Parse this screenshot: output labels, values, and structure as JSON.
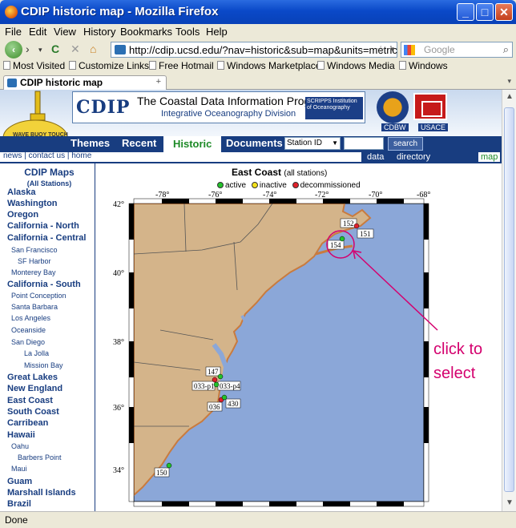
{
  "window": {
    "title": "CDIP historic map - Mozilla Firefox"
  },
  "menu": [
    "File",
    "Edit",
    "View",
    "History",
    "Bookmarks",
    "Tools",
    "Help"
  ],
  "toolbar": {
    "url": "http://cdip.ucsd.edu/?nav=historic&sub=map&units=metric",
    "search_placeholder": "Google"
  },
  "bookmarks": [
    "Most Visited",
    "Customize Links",
    "Free Hotmail",
    "Windows Marketplace",
    "Windows Media",
    "Windows"
  ],
  "tab": {
    "label": "CDIP historic map"
  },
  "site": {
    "logo": "CDIP",
    "title": "The Coastal Data Information Program",
    "subtitle": "Integrative Oceanography Division",
    "scripps": "SCRIPPS Institution of Oceanography",
    "cdbw": "CDBW",
    "usace": "USACE",
    "buoy_text": "WAVE BUOY TOUCH",
    "nav_tabs": [
      "Themes",
      "Recent",
      "Historic",
      "Documents"
    ],
    "active_tab": "Historic",
    "station_select": "Station ID",
    "search_button": "search",
    "sub_links": "news | contact us | home",
    "right_links": [
      "data",
      "directory",
      "map"
    ]
  },
  "sidebar": {
    "title": "CDIP Maps",
    "subtitle": "(All Stations)",
    "items": [
      {
        "label": "Alaska",
        "level": 0
      },
      {
        "label": "Washington",
        "level": 0
      },
      {
        "label": "Oregon",
        "level": 0
      },
      {
        "label": "California - North",
        "level": 0
      },
      {
        "label": "California - Central",
        "level": 0
      },
      {
        "label": "San Francisco",
        "level": 1
      },
      {
        "label": "SF Harbor",
        "level": 2
      },
      {
        "label": "Monterey Bay",
        "level": 1
      },
      {
        "label": "California - South",
        "level": 0
      },
      {
        "label": "Point Conception",
        "level": 1
      },
      {
        "label": "Santa Barbara",
        "level": 1
      },
      {
        "label": "Los Angeles",
        "level": 1
      },
      {
        "label": "Oceanside",
        "level": 1
      },
      {
        "label": "San Diego",
        "level": 1
      },
      {
        "label": "La Jolla",
        "level": 2
      },
      {
        "label": "Mission Bay",
        "level": 2
      },
      {
        "label": "Great Lakes",
        "level": 0
      },
      {
        "label": "New England",
        "level": 0
      },
      {
        "label": "East Coast",
        "level": 0
      },
      {
        "label": "South Coast",
        "level": 0
      },
      {
        "label": "Carribean",
        "level": 0
      },
      {
        "label": "Hawaii",
        "level": 0
      },
      {
        "label": "Oahu",
        "level": 1
      },
      {
        "label": "Barbers Point",
        "level": 2
      },
      {
        "label": "Maui",
        "level": 1
      },
      {
        "label": "Guam",
        "level": 0
      },
      {
        "label": "Marshall Islands",
        "level": 0
      },
      {
        "label": "Brazil",
        "level": 0
      }
    ]
  },
  "map": {
    "title": "East Coast",
    "title_sub": "(all stations)",
    "legend": [
      {
        "label": "active",
        "color": "#22c22a"
      },
      {
        "label": "inactive",
        "color": "#f2e01a"
      },
      {
        "label": "decommissioned",
        "color": "#e0202a"
      }
    ],
    "lon_ticks": [
      "-78°",
      "-76°",
      "-74°",
      "-72°",
      "-70°",
      "-68°"
    ],
    "lat_ticks": [
      "42°",
      "40°",
      "38°",
      "36°",
      "34°"
    ],
    "stations": [
      {
        "id": "152",
        "status": "decommissioned"
      },
      {
        "id": "151",
        "status": "decommissioned"
      },
      {
        "id": "154",
        "status": "active"
      },
      {
        "id": "147",
        "status": "active"
      },
      {
        "id": "033-p1",
        "status": "decommissioned"
      },
      {
        "id": "033-p4",
        "status": "active"
      },
      {
        "id": "036",
        "status": "decommissioned"
      },
      {
        "id": "430",
        "status": "active"
      },
      {
        "id": "150",
        "status": "active"
      }
    ]
  },
  "annotation": "click to\nselect",
  "status": "Done",
  "colors": {
    "titlebar": "#0A49C8",
    "site_navy": "#183d80",
    "active_tab_text": "#1d8a27",
    "ocean": "#8ba7d8",
    "land": "#d4b48a",
    "annotation": "#d4006e"
  }
}
